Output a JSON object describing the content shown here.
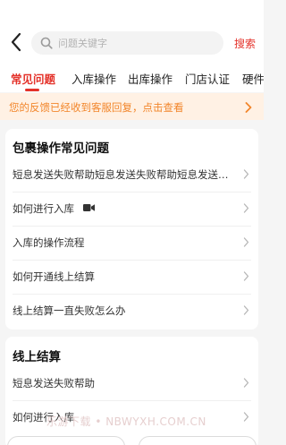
{
  "header": {
    "search_placeholder": "问题关键字",
    "search_button": "搜索"
  },
  "tabs": [
    {
      "label": "常见问题",
      "active": true
    },
    {
      "label": "入库操作"
    },
    {
      "label": "出库操作"
    },
    {
      "label": "门店认证"
    },
    {
      "label": "硬件"
    }
  ],
  "notice": {
    "text": "您的反馈已经收到客服回复，点击查看"
  },
  "sections": [
    {
      "title": "包裹操作常见问题",
      "items": [
        {
          "label": "短息发送失败帮助短息发送失败帮助短息发送失败帮助"
        },
        {
          "label": "如何进行入库",
          "icon": "video-icon"
        },
        {
          "label": "入库的操作流程"
        },
        {
          "label": "如何开通线上结算"
        },
        {
          "label": "线上结算一直失败怎么办"
        }
      ]
    },
    {
      "title": "线上结算",
      "items": [
        {
          "label": "短息发送失败帮助"
        },
        {
          "label": "如何进行入库"
        }
      ]
    }
  ],
  "watermark": "乐游下载 • NBWYXH.COM.CN",
  "colors": {
    "accent": "#e4322a",
    "notice_text": "#f2862b",
    "notice_bg": "#fff1e4"
  }
}
